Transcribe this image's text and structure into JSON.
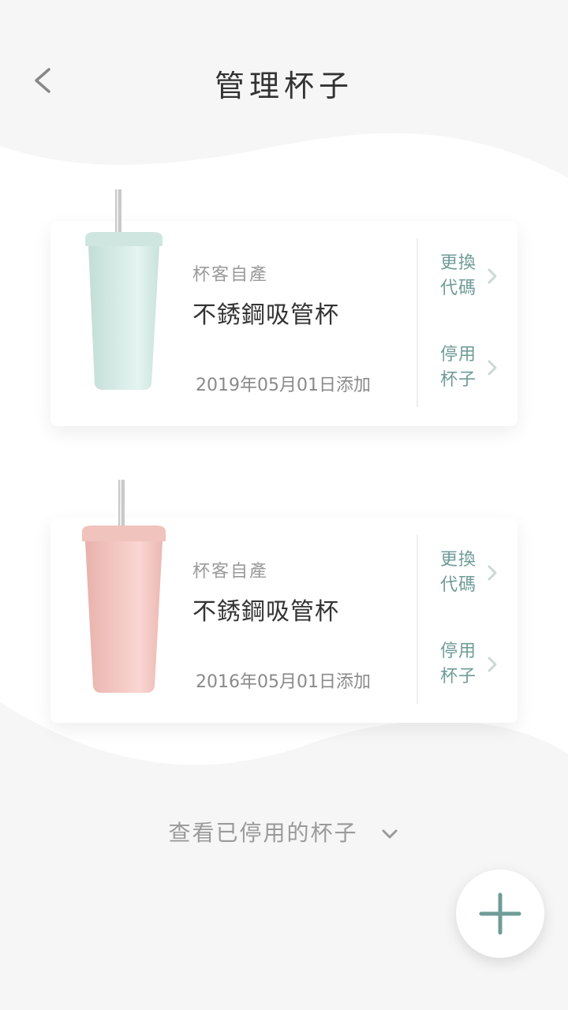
{
  "header": {
    "title": "管理杯子",
    "back_icon": "chevron-left-icon"
  },
  "cups": [
    {
      "color": "#cfe8e2",
      "brand": "杯客自產",
      "name": "不銹鋼吸管杯",
      "date": "2019年05月01日添加",
      "change_code_label": "更換代碼",
      "disable_label": "停用杯子"
    },
    {
      "color": "#f2c6c1",
      "brand": "杯客自產",
      "name": "不銹鋼吸管杯",
      "date": "2016年05月01日添加",
      "change_code_label": "更換代碼",
      "disable_label": "停用杯子"
    }
  ],
  "footer": {
    "view_disabled_label": "查看已停用的杯子",
    "add_icon": "plus-icon"
  },
  "colors": {
    "accent": "#6f9c98",
    "background": "#f6f6f6",
    "card": "#ffffff"
  }
}
